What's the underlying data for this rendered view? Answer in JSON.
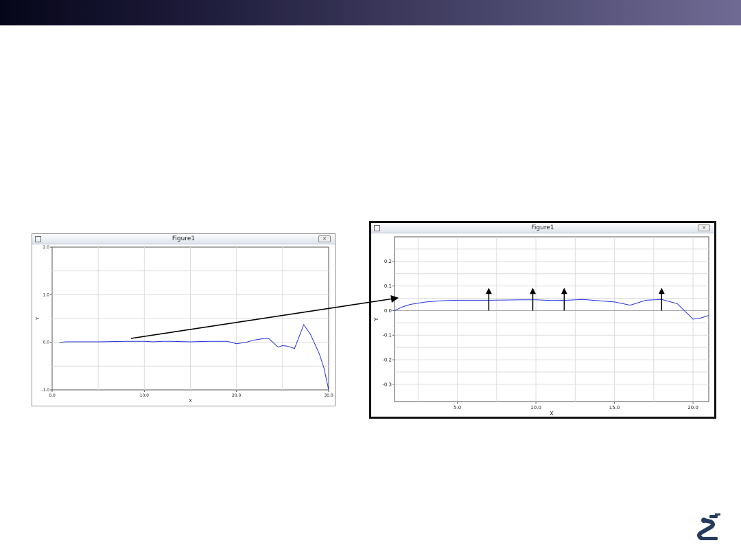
{
  "slide": {
    "topbar_gradient": [
      "#06061a",
      "#6f6b94"
    ],
    "logo_icon": "robot-arm-logo-icon"
  },
  "windows": [
    {
      "title": "Figure1",
      "close_icon": "close-icon",
      "system_icon": "window-menu-icon"
    },
    {
      "title": "Figure1",
      "close_icon": "close-icon",
      "system_icon": "window-menu-icon"
    }
  ],
  "annotation": {
    "arrow_count": 4,
    "arrow_x": [
      7.0,
      9.8,
      11.8,
      18.0
    ]
  },
  "chart_data": [
    {
      "type": "line",
      "title": "",
      "xlabel": "X",
      "ylabel": "Y",
      "xlim": [
        0,
        30
      ],
      "ylim": [
        -1,
        2
      ],
      "xticks": [
        0,
        10,
        20,
        30
      ],
      "xtick_labels": [
        "0.0",
        "10.0",
        "20.0",
        "30.0"
      ],
      "yticks": [
        -1,
        0,
        1,
        2
      ],
      "ytick_labels": [
        "-1.0",
        "0.0",
        "1.0",
        "2.0"
      ],
      "grid": true,
      "line_color": "#2233dd",
      "series": [
        {
          "x": [
            0.8,
            1.5,
            3,
            5,
            8,
            10,
            11,
            12,
            13,
            15,
            17,
            19,
            20,
            21,
            22,
            23,
            23.5,
            24.5,
            25,
            25.5,
            26.3,
            27.3,
            28,
            29,
            29.5,
            30
          ],
          "y": [
            0.0,
            0.01,
            0.01,
            0.01,
            0.02,
            0.02,
            0.01,
            0.02,
            0.02,
            0.01,
            0.02,
            0.02,
            -0.03,
            0.0,
            0.05,
            0.08,
            0.08,
            -0.1,
            -0.07,
            -0.08,
            -0.13,
            0.37,
            0.18,
            -0.25,
            -0.55,
            -1.0
          ]
        }
      ]
    },
    {
      "type": "line",
      "title": "",
      "xlabel": "X",
      "ylabel": "Y",
      "xlim": [
        1,
        21
      ],
      "ylim": [
        -0.37,
        0.3
      ],
      "xticks": [
        5,
        10,
        15,
        20
      ],
      "xtick_labels": [
        "5.0",
        "10.0",
        "15.0",
        "20.0"
      ],
      "yticks": [
        -0.3,
        -0.2,
        -0.1,
        0.0,
        0.1,
        0.2
      ],
      "ytick_labels": [
        "-0.3",
        "-0.2",
        "-0.1",
        "0.0",
        "0.1",
        "0.2"
      ],
      "grid": true,
      "line_color": "#2233dd",
      "series": [
        {
          "x": [
            1,
            1.5,
            2,
            3,
            4,
            5,
            6,
            7,
            8,
            9,
            10,
            11,
            12,
            13,
            14,
            15,
            16,
            17,
            18,
            19,
            20,
            20.5,
            21
          ],
          "y": [
            0.0,
            0.015,
            0.025,
            0.035,
            0.04,
            0.042,
            0.042,
            0.042,
            0.043,
            0.044,
            0.044,
            0.041,
            0.042,
            0.045,
            0.04,
            0.035,
            0.022,
            0.042,
            0.045,
            0.028,
            -0.035,
            -0.03,
            -0.02
          ]
        }
      ]
    }
  ]
}
